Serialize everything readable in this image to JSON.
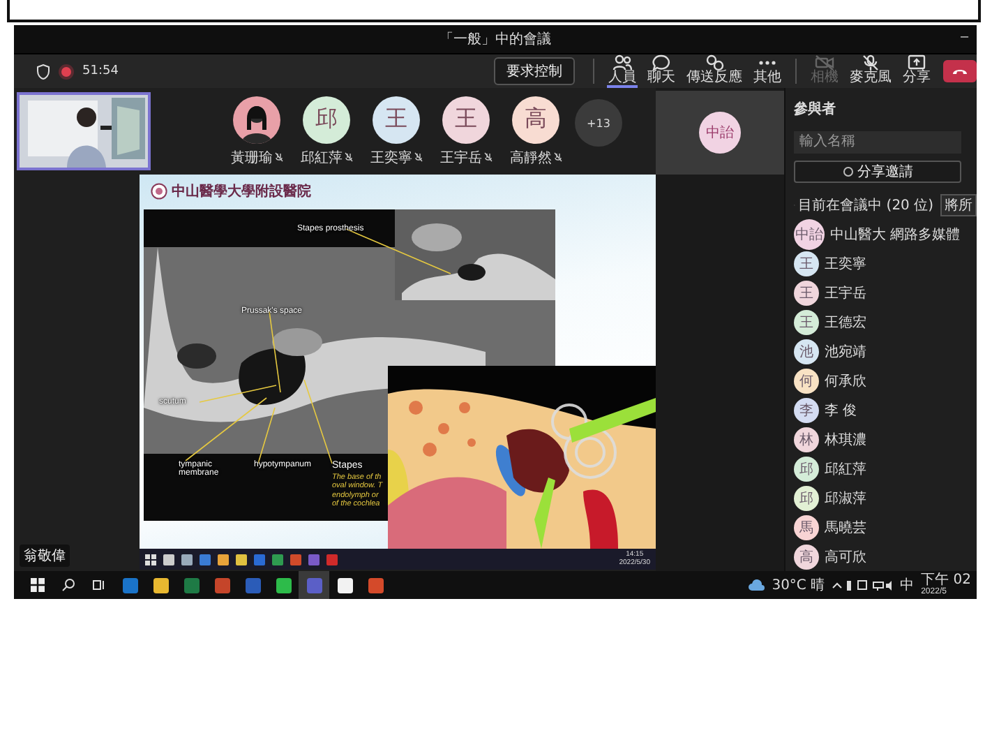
{
  "window": {
    "title": "「一般」中的會議",
    "minimize": "–"
  },
  "toolbar": {
    "recording": true,
    "timer": "51:54",
    "request_control": "要求控制",
    "buttons": [
      {
        "kind": "people",
        "label": "人員",
        "selected": true,
        "disabled": false
      },
      {
        "kind": "chat",
        "label": "聊天",
        "selected": false,
        "disabled": false
      },
      {
        "kind": "react",
        "label": "傳送反應",
        "selected": false,
        "disabled": false
      },
      {
        "kind": "more",
        "label": "其他",
        "selected": false,
        "disabled": false
      },
      {
        "kind": "camera",
        "label": "相機",
        "selected": false,
        "disabled": true
      },
      {
        "kind": "mic",
        "label": "麥克風",
        "selected": false,
        "disabled": false
      },
      {
        "kind": "share",
        "label": "分享",
        "selected": false,
        "disabled": false
      }
    ]
  },
  "participants_row": {
    "tiles": [
      {
        "name": "黃珊瑜",
        "color": "#e8a0a8"
      },
      {
        "kind": "initials",
        "initials": "邱",
        "name": "邱紅萍",
        "color": "#d4ecd8"
      },
      {
        "kind": "initials",
        "initials": "王",
        "name": "王奕寧",
        "color": "#d6e6f2"
      },
      {
        "kind": "initials",
        "initials": "王",
        "name": "王宇岳",
        "color": "#f0d6dc"
      },
      {
        "kind": "initials",
        "initials": "高",
        "name": "高靜然",
        "color": "#f8dcd2"
      }
    ],
    "overflow": "+13"
  },
  "spotlight_tile": {
    "initials": "中詒",
    "color": "#f1d3e3"
  },
  "presenter_tag": "翁敬偉",
  "slide": {
    "logo_text": "中山醫學大學附設醫院",
    "labels": [
      "Stapes prosthesis",
      "Prussak's space",
      "scutum",
      "tympanic membrane",
      "hypotympanum",
      "Stapes"
    ],
    "note_lines": [
      "The base of th",
      "oval window. T",
      "endolymph or",
      "of the cochlea"
    ]
  },
  "shared_taskbar": {
    "time": "14:15",
    "date": "2022/5/30"
  },
  "people_panel": {
    "title": "參與者",
    "search_placeholder": "輸入名稱",
    "share_invite": "分享邀請",
    "section": "目前在會議中 (20 位)",
    "mute_all": "將所",
    "people": [
      {
        "initials": "中詒",
        "name": "中山醫大 網路多媒體",
        "color": "#f1d3e3"
      },
      {
        "initials": "王",
        "name": "王奕寧",
        "color": "#d6e6f2"
      },
      {
        "initials": "王",
        "name": "王宇岳",
        "color": "#f0d6dc"
      },
      {
        "initials": "王",
        "name": "王德宏",
        "color": "#d4ecd8"
      },
      {
        "initials": "池",
        "name": "池宛靖",
        "color": "#d6e6f2"
      },
      {
        "initials": "何",
        "name": "何承欣",
        "color": "#f8e2c4"
      },
      {
        "initials": "李",
        "name": "李 俊",
        "color": "#d4dcf2"
      },
      {
        "initials": "林",
        "name": "林琪濃",
        "color": "#f0d6dc"
      },
      {
        "initials": "邱",
        "name": "邱紅萍",
        "color": "#d4ecd8"
      },
      {
        "initials": "邱",
        "name": "邱淑萍",
        "color": "#e2f0d4"
      },
      {
        "initials": "馬",
        "name": "馬曉芸",
        "color": "#f8d4d4"
      },
      {
        "initials": "高",
        "name": "高可欣",
        "color": "#f0d6dc"
      }
    ]
  },
  "taskbar": {
    "apps": [
      {
        "kind": "mail",
        "selected": false
      },
      {
        "kind": "folder",
        "selected": false
      },
      {
        "kind": "sheet",
        "selected": false
      },
      {
        "kind": "slides",
        "selected": false
      },
      {
        "kind": "doc",
        "selected": false
      },
      {
        "kind": "chat",
        "selected": false
      },
      {
        "kind": "meeting",
        "selected": true
      },
      {
        "kind": "app",
        "selected": false
      },
      {
        "kind": "browser",
        "selected": false
      }
    ],
    "weather": "30°C 晴",
    "ime": "中",
    "time": "下午 02",
    "date": "2022/5"
  }
}
